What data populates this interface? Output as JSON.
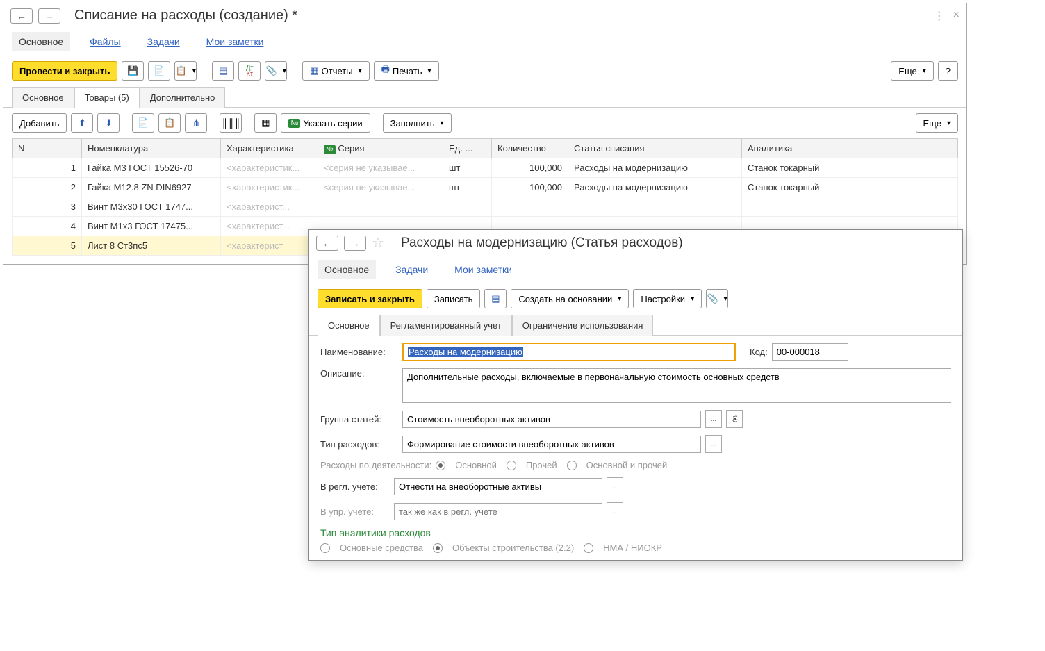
{
  "main": {
    "title": "Списание на расходы (создание) *",
    "linkTabs": {
      "main": "Основное",
      "files": "Файлы",
      "tasks": "Задачи",
      "notes": "Мои заметки"
    },
    "toolbar": {
      "postClose": "Провести и закрыть",
      "reports": "Отчеты",
      "print": "Печать",
      "more": "Еще",
      "help": "?"
    },
    "subTabs": {
      "main": "Основное",
      "goods": "Товары (5)",
      "extra": "Дополнительно"
    },
    "tableToolbar": {
      "add": "Добавить",
      "series": "Указать серии",
      "fill": "Заполнить",
      "more": "Еще"
    },
    "columns": {
      "n": "N",
      "nomen": "Номенклатура",
      "char": "Характеристика",
      "series": "Серия",
      "unit": "Ед. ...",
      "qty": "Количество",
      "article": "Статья списания",
      "analytics": "Аналитика"
    },
    "placeholders": {
      "char": "<характеристик...",
      "charShort": "<характерист...",
      "charShorter": "<характерист",
      "series": "<серия не указывае..."
    },
    "rows": [
      {
        "n": "1",
        "nomen": "Гайка М3 ГОСТ 15526-70",
        "unit": "шт",
        "qty": "100,000",
        "article": "Расходы на модернизацию",
        "analytics": "Станок токарный"
      },
      {
        "n": "2",
        "nomen": "Гайка М12.8 ZN DIN6927",
        "unit": "шт",
        "qty": "100,000",
        "article": "Расходы на модернизацию",
        "analytics": "Станок токарный"
      },
      {
        "n": "3",
        "nomen": "Винт М3х30 ГОСТ 1747...",
        "unit": "",
        "qty": "",
        "article": "",
        "analytics": ""
      },
      {
        "n": "4",
        "nomen": "Винт М1х3 ГОСТ 17475...",
        "unit": "",
        "qty": "",
        "article": "",
        "analytics": ""
      },
      {
        "n": "5",
        "nomen": "Лист 8 Ст3пс5",
        "unit": "",
        "qty": "",
        "article": "",
        "analytics": ""
      }
    ]
  },
  "dialog": {
    "title": "Расходы на модернизацию (Статья расходов)",
    "linkTabs": {
      "main": "Основное",
      "tasks": "Задачи",
      "notes": "Мои заметки"
    },
    "toolbar": {
      "saveClose": "Записать и закрыть",
      "save": "Записать",
      "createBased": "Создать на основании",
      "settings": "Настройки"
    },
    "subTabs": {
      "main": "Основное",
      "regl": "Регламентированный учет",
      "restrict": "Ограничение использования"
    },
    "labels": {
      "name": "Наименование:",
      "code": "Код:",
      "desc": "Описание:",
      "group": "Группа статей:",
      "type": "Тип расходов:",
      "activity": "Расходы по деятельности:",
      "regl": "В регл. учете:",
      "upr": "В упр. учете:",
      "section": "Тип аналитики расходов"
    },
    "values": {
      "name": "Расходы на модернизацию",
      "code": "00-000018",
      "desc": "Дополнительные расходы, включаемые в первоначальную стоимость основных средств",
      "group": "Стоимость внеоборотных активов",
      "type": "Формирование стоимости внеоборотных активов",
      "regl": "Отнести на внеоборотные активы",
      "uprPlaceholder": "так же как в регл. учете"
    },
    "radios": {
      "activity": {
        "main": "Основной",
        "other": "Прочей",
        "both": "Основной и прочей"
      },
      "analytics": {
        "os": "Основные средства",
        "obj": "Объекты строительства (2.2)",
        "nma": "НМА / НИОКР"
      }
    }
  }
}
